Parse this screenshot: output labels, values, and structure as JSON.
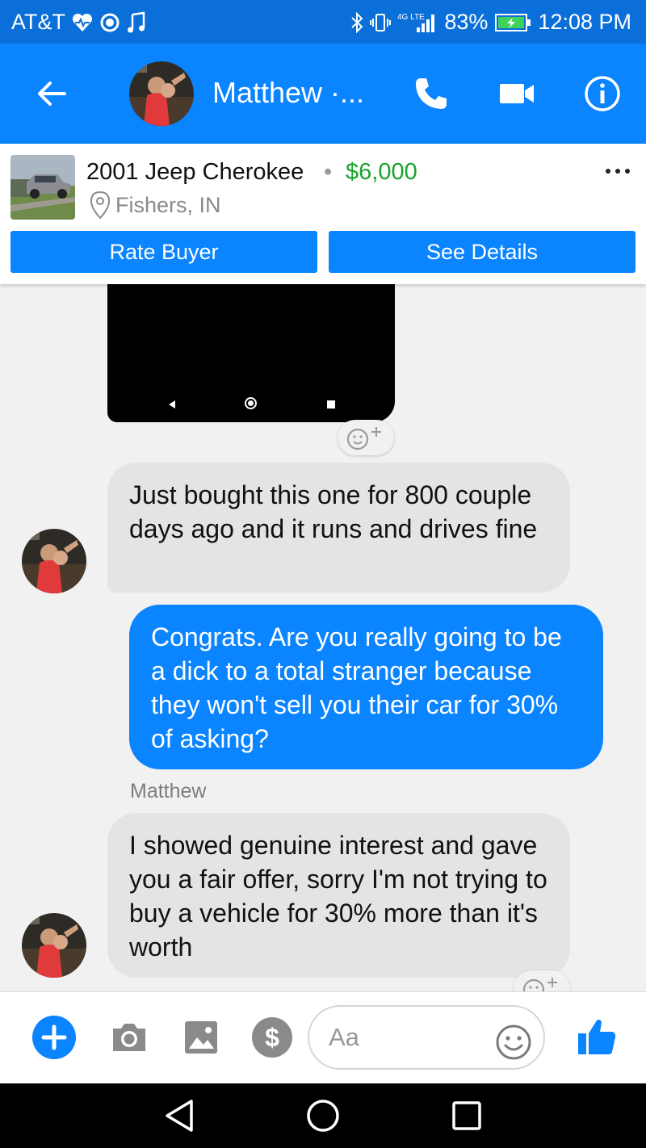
{
  "status_bar": {
    "carrier": "AT&T",
    "network_badge": "4G LTE",
    "battery": "83%",
    "time": "12:08 PM",
    "icons": [
      "heart-pulse-icon",
      "circle-icon",
      "music-note-icon",
      "bluetooth-icon",
      "vibrate-icon",
      "signal-icon",
      "battery-charging-icon"
    ]
  },
  "header": {
    "contact_name": "Matthew ·...",
    "icons": [
      "back-arrow-icon",
      "phone-icon",
      "video-camera-icon",
      "info-icon"
    ],
    "background_color": "#0a84ff"
  },
  "listing": {
    "title": "2001 Jeep Cherokee",
    "separator": "•",
    "price": "$6,000",
    "location": "Fishers, IN",
    "rate_buyer_label": "Rate Buyer",
    "see_details_label": "See Details",
    "price_color": "#1aa32e"
  },
  "messages": [
    {
      "sender": "them",
      "text": "Just bought this one for 800 couple days ago and it runs and drives fine"
    },
    {
      "sender": "me",
      "text": "Congrats. Are you really going to be a dick to a total stranger because they won't sell you their car for 30% of asking?"
    },
    {
      "sender": "them",
      "sender_label": "Matthew",
      "text": "I showed genuine interest and gave you a fair offer, sorry I'm not trying to buy a vehicle for 30% more than it's worth"
    }
  ],
  "composer": {
    "placeholder": "Aa",
    "icons": [
      "plus-icon",
      "camera-icon",
      "image-icon",
      "dollar-icon",
      "emoji-icon",
      "thumbs-up-icon"
    ]
  },
  "android_nav": {
    "icons": [
      "nav-back-icon",
      "nav-home-icon",
      "nav-recent-icon"
    ]
  },
  "colors": {
    "messenger_blue": "#0a84ff",
    "status_bar": "#0a6fd8",
    "incoming_bubble": "#e4e4e4",
    "background": "#f1f1f1"
  }
}
